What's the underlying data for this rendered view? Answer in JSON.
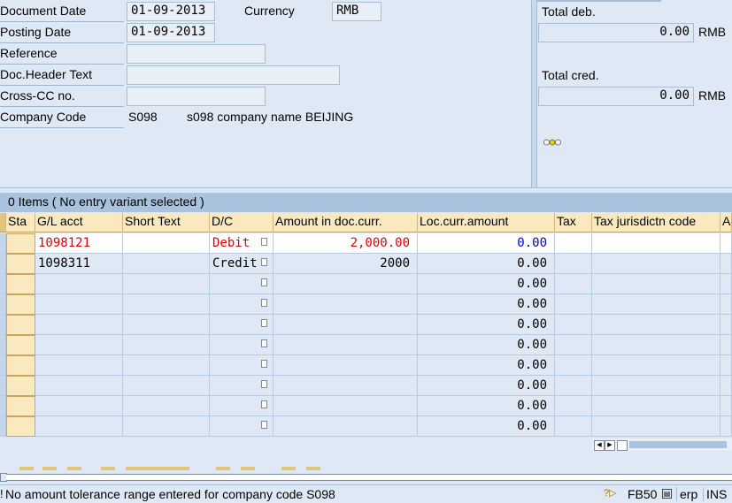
{
  "header": {
    "doc_date_label": "Document Date",
    "doc_date": "01-09-2013",
    "currency_label": "Currency",
    "currency": "RMB",
    "posting_date_label": "Posting Date",
    "posting_date": "01-09-2013",
    "reference_label": "Reference",
    "reference": "",
    "doc_header_label": "Doc.Header Text",
    "doc_header": "",
    "cross_cc_label": "Cross-CC no.",
    "cross_cc": "",
    "company_code_label": "Company Code",
    "company_code": "S098",
    "company_name": "s098 company name BEIJING"
  },
  "totals": {
    "debit_label": "Total deb.",
    "debit_value": "0.00",
    "credit_label": "Total cred.",
    "credit_value": "0.00",
    "currency": "RMB",
    "status_icon": "traffic-light-icon"
  },
  "table": {
    "title": "0 Items ( No entry variant selected )",
    "columns": [
      "Sta",
      "G/L acct",
      "Short Text",
      "D/C",
      "Amount in doc.curr.",
      "Loc.curr.amount",
      "Tax",
      "Tax jurisdictn code",
      "As"
    ],
    "rows": [
      {
        "gl": "1098121",
        "short": "",
        "dc": "Debit",
        "amount": "2,000.00",
        "loc": "0.00"
      },
      {
        "gl": "1098311",
        "short": "",
        "dc": "Credit",
        "amount": "2000",
        "loc": "0.00"
      },
      {
        "gl": "",
        "short": "",
        "dc": "",
        "amount": "",
        "loc": "0.00"
      },
      {
        "gl": "",
        "short": "",
        "dc": "",
        "amount": "",
        "loc": "0.00"
      },
      {
        "gl": "",
        "short": "",
        "dc": "",
        "amount": "",
        "loc": "0.00"
      },
      {
        "gl": "",
        "short": "",
        "dc": "",
        "amount": "",
        "loc": "0.00"
      },
      {
        "gl": "",
        "short": "",
        "dc": "",
        "amount": "",
        "loc": "0.00"
      },
      {
        "gl": "",
        "short": "",
        "dc": "",
        "amount": "",
        "loc": "0.00"
      },
      {
        "gl": "",
        "short": "",
        "dc": "",
        "amount": "",
        "loc": "0.00"
      },
      {
        "gl": "",
        "short": "",
        "dc": "",
        "amount": "",
        "loc": "0.00"
      }
    ]
  },
  "status_bar": {
    "message": "No amount tolerance range entered for company code S098",
    "tcode": "FB50",
    "system": "erp",
    "mode": "INS"
  },
  "colors": {
    "highlight_red": "#e00000",
    "blue_value": "#0000d0",
    "header_yellow": "#fae9be"
  }
}
